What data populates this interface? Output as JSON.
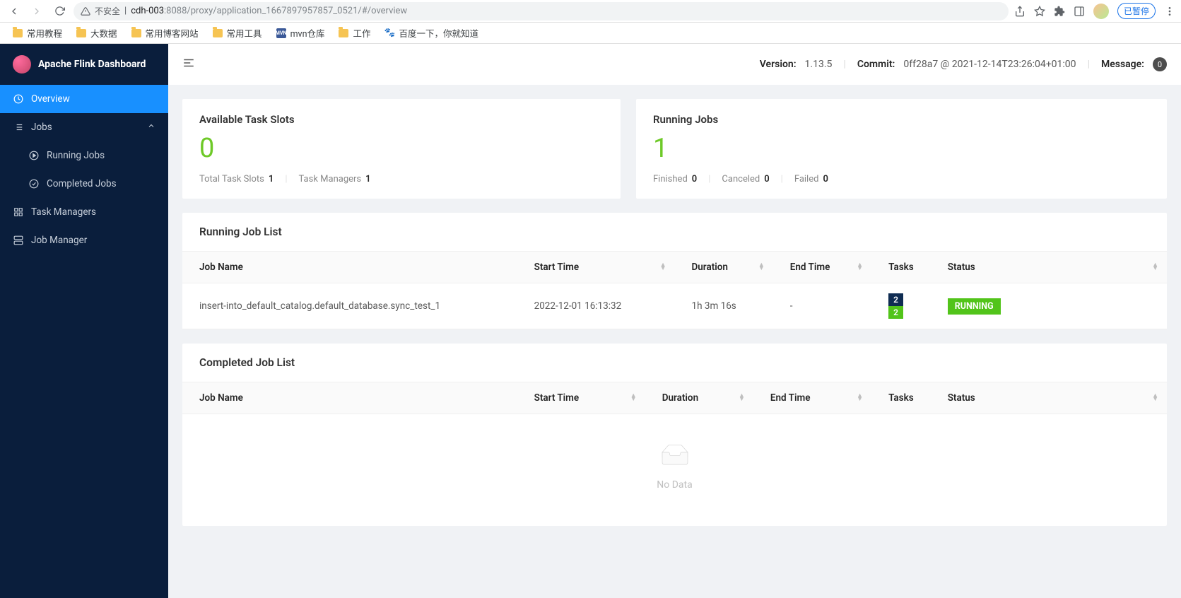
{
  "browser": {
    "url_prefix_insecure": "不安全",
    "url_host": "cdh-003",
    "url_port": ":8088",
    "url_path": "/proxy/application_1667897957857_0521/#/overview",
    "paused_label": "已暂停"
  },
  "bookmarks": [
    "常用教程",
    "大数据",
    "常用博客网站",
    "常用工具",
    "mvn仓库",
    "工作",
    "百度一下，你就知道"
  ],
  "sidebar": {
    "title": "Apache Flink Dashboard",
    "items": {
      "overview": "Overview",
      "jobs": "Jobs",
      "running_jobs": "Running Jobs",
      "completed_jobs": "Completed Jobs",
      "task_managers": "Task Managers",
      "job_manager": "Job Manager"
    }
  },
  "header": {
    "version_label": "Version:",
    "version_value": "1.13.5",
    "commit_label": "Commit:",
    "commit_value": "0ff28a7 @ 2021-12-14T23:26:04+01:00",
    "message_label": "Message:",
    "message_badge": "0"
  },
  "cards": {
    "slots": {
      "title": "Available Task Slots",
      "value": "0",
      "total_label": "Total Task Slots",
      "total_value": "1",
      "tm_label": "Task Managers",
      "tm_value": "1"
    },
    "running": {
      "title": "Running Jobs",
      "value": "1",
      "finished_label": "Finished",
      "finished_value": "0",
      "canceled_label": "Canceled",
      "canceled_value": "0",
      "failed_label": "Failed",
      "failed_value": "0"
    }
  },
  "table_headers": {
    "job_name": "Job Name",
    "start_time": "Start Time",
    "duration": "Duration",
    "end_time": "End Time",
    "tasks": "Tasks",
    "status": "Status"
  },
  "running_section": {
    "title": "Running Job List",
    "rows": [
      {
        "name": "insert-into_default_catalog.default_database.sync_test_1",
        "start": "2022-12-01 16:13:32",
        "duration": "1h 3m 16s",
        "end": "-",
        "tasks_a": "2",
        "tasks_b": "2",
        "status": "RUNNING"
      }
    ]
  },
  "completed_section": {
    "title": "Completed Job List",
    "empty_text": "No Data"
  }
}
